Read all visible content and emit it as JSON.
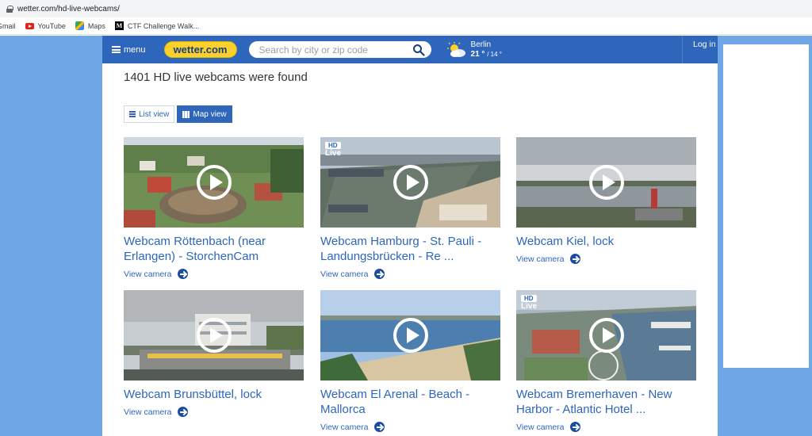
{
  "browser": {
    "url": "wetter.com/hd-live-webcams/",
    "bookmarks": [
      {
        "label": "Gmail",
        "icon": "gmail-icon"
      },
      {
        "label": "YouTube",
        "icon": "youtube-icon"
      },
      {
        "label": "Maps",
        "icon": "maps-icon"
      },
      {
        "label": "CTF Challenge Walk...",
        "icon": "medium-icon"
      }
    ]
  },
  "header": {
    "menu_label": "menu",
    "logo_text": "wetter.com",
    "search_placeholder": "Search by city or zip code",
    "weather": {
      "city": "Berlin",
      "temp_high": "21 °",
      "temp_low": "/ 14 °",
      "icon": "partly-cloudy-icon"
    },
    "login_label": "Log in"
  },
  "results": {
    "title": "1401 HD live webcams were found"
  },
  "view_toggle": {
    "list_label": "List view",
    "map_label": "Map view",
    "active": "map"
  },
  "webcams": [
    {
      "title": "Webcam Röttenbach (near Erlangen) - StorchenCam",
      "link": "View camera",
      "hd_live": false
    },
    {
      "title": "Webcam Hamburg - St. Pauli - Landungsbrücken - Re ...",
      "link": "View camera",
      "hd_live": true,
      "badge_hd": "HD",
      "badge_live": "Live"
    },
    {
      "title": "Webcam Kiel, lock",
      "link": "View camera",
      "hd_live": false
    },
    {
      "title": "Webcam Brunsbüttel, lock",
      "link": "View camera",
      "hd_live": false
    },
    {
      "title": "Webcam El Arenal - Beach - Mallorca",
      "link": "View camera",
      "hd_live": false
    },
    {
      "title": "Webcam Bremerhaven - New Harbor - Atlantic Hotel ...",
      "link": "View camera",
      "hd_live": true,
      "badge_hd": "HD",
      "badge_live": "Live"
    }
  ],
  "colors": {
    "brand_blue": "#2d66bb",
    "logo_yellow": "#fcd02d",
    "page_background": "#6ea6e6"
  }
}
